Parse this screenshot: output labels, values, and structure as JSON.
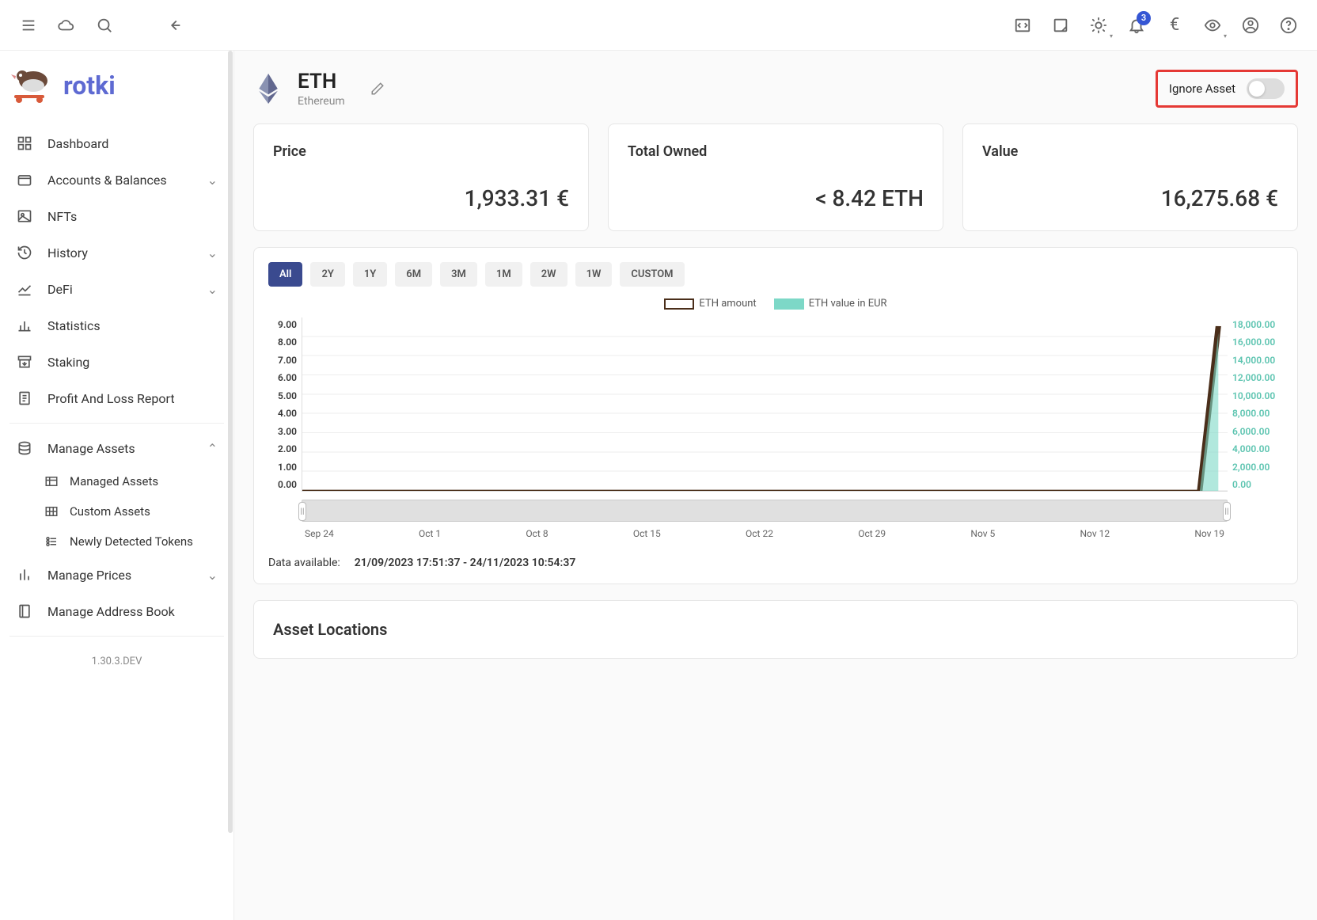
{
  "app_name": "rotki",
  "version": "1.30.3.DEV",
  "topbar": {
    "notification_count": "3",
    "currency_symbol": "€"
  },
  "sidebar": {
    "items": [
      {
        "label": "Dashboard"
      },
      {
        "label": "Accounts & Balances",
        "expandable": true
      },
      {
        "label": "NFTs"
      },
      {
        "label": "History",
        "expandable": true
      },
      {
        "label": "DeFi",
        "expandable": true
      },
      {
        "label": "Statistics"
      },
      {
        "label": "Staking"
      },
      {
        "label": "Profit And Loss Report"
      }
    ],
    "manage_assets_label": "Manage Assets",
    "manage_assets_sub": [
      {
        "label": "Managed Assets"
      },
      {
        "label": "Custom Assets"
      },
      {
        "label": "Newly Detected Tokens"
      }
    ],
    "manage_prices_label": "Manage Prices",
    "address_book_label": "Manage Address Book"
  },
  "asset": {
    "symbol": "ETH",
    "name": "Ethereum",
    "ignore_label": "Ignore Asset",
    "ignore_state": false
  },
  "cards": {
    "price_label": "Price",
    "price_value": "1,933.31 €",
    "owned_label": "Total Owned",
    "owned_value": "< 8.42 ETH",
    "value_label": "Value",
    "value_value": "16,275.68 €"
  },
  "ranges": [
    "All",
    "2Y",
    "1Y",
    "6M",
    "3M",
    "1M",
    "2W",
    "1W",
    "CUSTOM"
  ],
  "active_range": "All",
  "legend": {
    "a": "ETH amount",
    "b": "ETH value in EUR"
  },
  "chart_data": {
    "type": "line",
    "xlabel": "",
    "ylabel_left": "ETH amount",
    "ylabel_right": "ETH value in EUR",
    "y_left_ticks": [
      "9.00",
      "8.00",
      "7.00",
      "6.00",
      "5.00",
      "4.00",
      "3.00",
      "2.00",
      "1.00",
      "0.00"
    ],
    "y_right_ticks": [
      "18,000.00",
      "16,000.00",
      "14,000.00",
      "12,000.00",
      "10,000.00",
      "8,000.00",
      "6,000.00",
      "4,000.00",
      "2,000.00",
      "0.00"
    ],
    "x_ticks": [
      "Sep 24",
      "Oct 1",
      "Oct 8",
      "Oct 15",
      "Oct 22",
      "Oct 29",
      "Nov 5",
      "Nov 12",
      "Nov 19"
    ],
    "series": [
      {
        "name": "ETH amount",
        "color": "#4a2e1a",
        "approx_values": [
          0,
          0,
          0,
          0,
          0,
          0,
          0,
          0,
          0,
          8.42
        ]
      },
      {
        "name": "ETH value in EUR",
        "color": "#7dd8c7",
        "approx_values": [
          0,
          0,
          0,
          0,
          0,
          0,
          0,
          0,
          0,
          16275.68
        ]
      }
    ],
    "note": "Both series flat at 0 across most of range; sharp vertical rise at far right (~Nov 23)."
  },
  "data_available": {
    "label": "Data available:",
    "range": "21/09/2023 17:51:37 - 24/11/2023 10:54:37"
  },
  "locations_title": "Asset Locations"
}
